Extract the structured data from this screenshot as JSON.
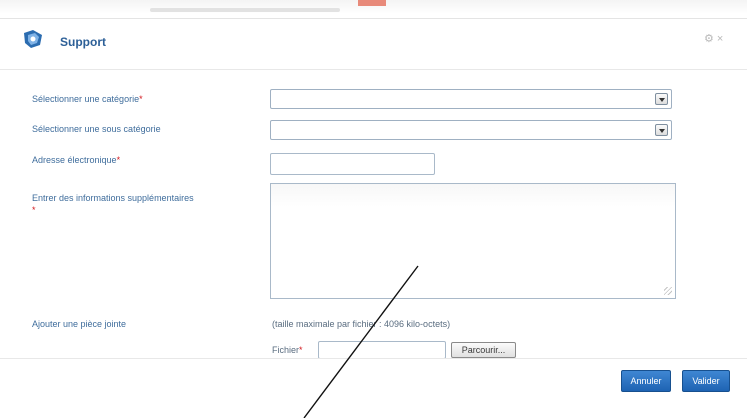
{
  "header": {
    "title": "Support"
  },
  "form": {
    "category": {
      "label": "Sélectionner une catégorie",
      "required_mark": "*"
    },
    "subcategory": {
      "label": "Sélectionner une sous catégorie"
    },
    "email": {
      "label": "Adresse électronique",
      "required_mark": "*"
    },
    "info": {
      "label": "Entrer des informations supplémentaires",
      "required_mark": "*"
    },
    "attachment": {
      "label": "Ajouter une pièce jointe",
      "note": "(taille maximale par fichier : 4096 kilo-octets)",
      "file_label": "Fichier",
      "required_mark": "*",
      "browse_label": "Parcourir..."
    }
  },
  "footer": {
    "cancel_label": "Annuler",
    "submit_label": "Valider"
  },
  "colors": {
    "accent": "#2c5f97",
    "required": "#d2161c",
    "button": "#1e63b3"
  }
}
